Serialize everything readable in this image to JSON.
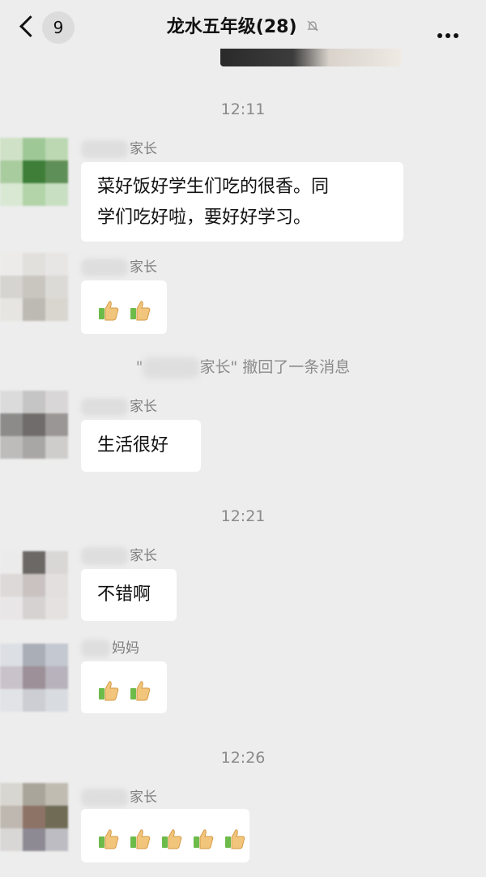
{
  "header": {
    "back_count": "9",
    "title": "龙水五年级(28)",
    "mute_icon": "bell-slash-icon",
    "more_icon": "more-dots-icon"
  },
  "timestamps": [
    "12:11",
    "12:21",
    "12:26"
  ],
  "messages": [
    {
      "nick": "家长",
      "text_line1": "菜好饭好学生们吃的很香。同",
      "text_line2": "学们吃好啦，要好好学习。"
    },
    {
      "nick": "家长",
      "content": "thumbs-up x2"
    },
    {
      "nick": "家长",
      "text": "生活很好"
    },
    {
      "nick": "家长",
      "text": "不错啊"
    },
    {
      "nick": "妈妈",
      "content": "thumbs-up x2"
    },
    {
      "nick": "家长",
      "content": "thumbs-up x5"
    }
  ],
  "recall": {
    "quote_open": "\"",
    "text": "家长\" 撤回了一条消息"
  },
  "colors": {
    "background": "#ededed",
    "bubble": "#ffffff",
    "timestamp": "#8a8a8a",
    "thumb_skin": "#f2c57c",
    "thumb_cuff": "#6dbb4a"
  }
}
